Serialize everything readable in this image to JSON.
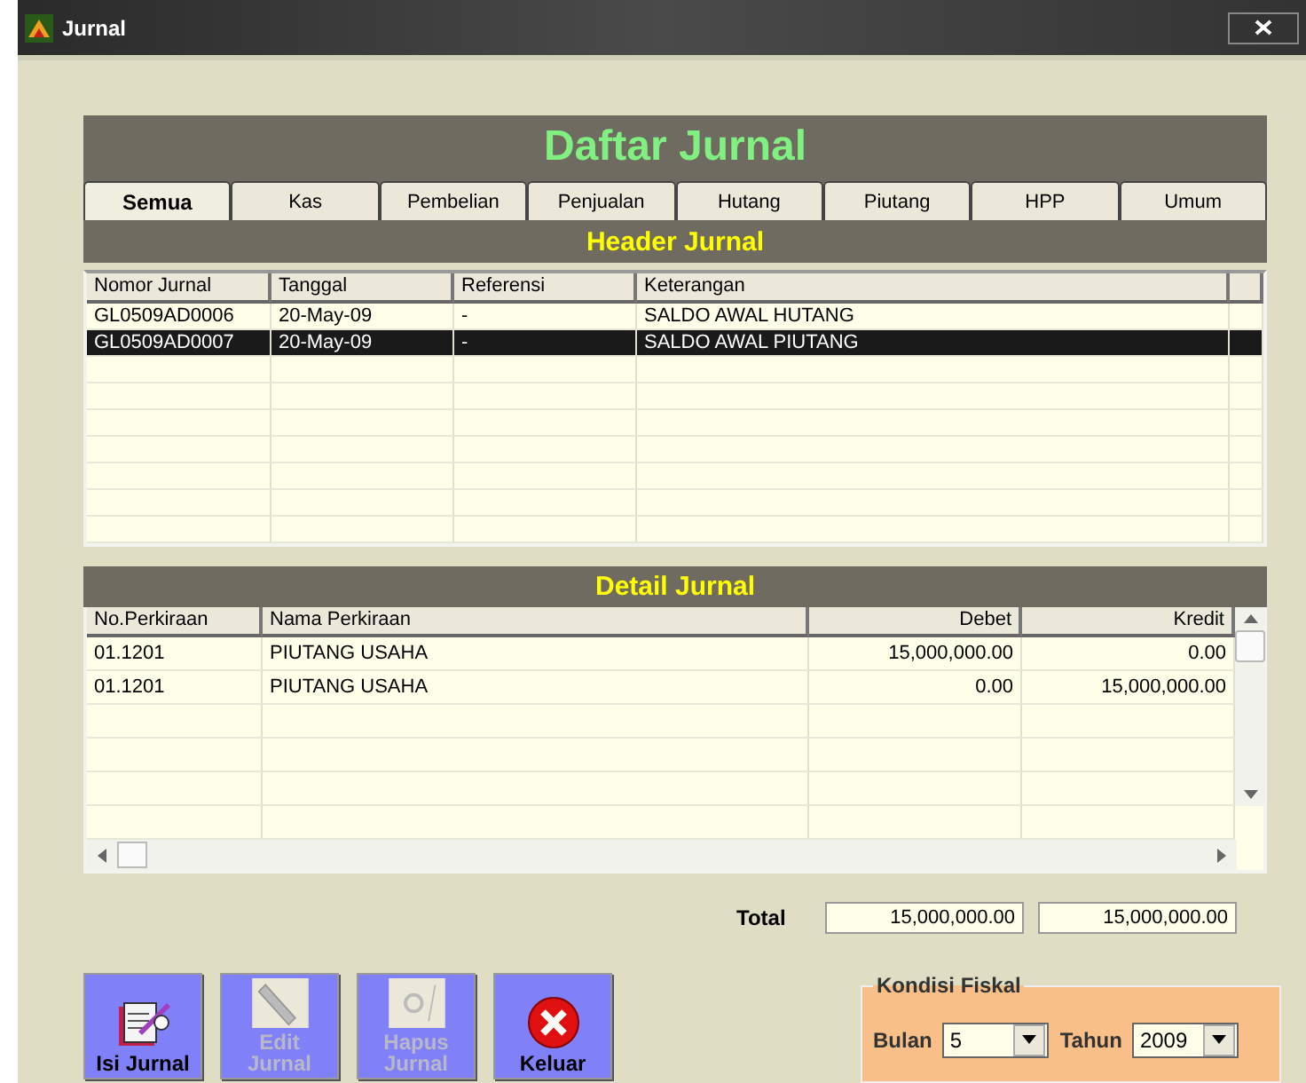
{
  "window": {
    "title": "Jurnal"
  },
  "heading": "Daftar Jurnal",
  "tabs": [
    {
      "label": "Semua",
      "selected": true
    },
    {
      "label": "Kas",
      "selected": false
    },
    {
      "label": "Pembelian",
      "selected": false
    },
    {
      "label": "Penjualan",
      "selected": false
    },
    {
      "label": "Hutang",
      "selected": false
    },
    {
      "label": "Piutang",
      "selected": false
    },
    {
      "label": "HPP",
      "selected": false
    },
    {
      "label": "Umum",
      "selected": false
    }
  ],
  "header_section": {
    "title": "Header Jurnal",
    "columns": [
      "Nomor Jurnal",
      "Tanggal",
      "Referensi",
      "Keterangan"
    ],
    "rows": [
      {
        "cells": [
          "GL0509AD0006",
          "20-May-09",
          "-",
          "SALDO AWAL HUTANG"
        ],
        "selected": false
      },
      {
        "cells": [
          "GL0509AD0007",
          "20-May-09",
          "-",
          "SALDO AWAL PIUTANG"
        ],
        "selected": true
      }
    ]
  },
  "detail_section": {
    "title": "Detail Jurnal",
    "columns": [
      "No.Perkiraan",
      "Nama Perkiraan",
      "Debet",
      "Kredit"
    ],
    "rows": [
      [
        "01.1201",
        "PIUTANG USAHA",
        "15,000,000.00",
        "0.00"
      ],
      [
        "01.1201",
        "PIUTANG USAHA",
        "0.00",
        "15,000,000.00"
      ]
    ]
  },
  "total": {
    "label": "Total",
    "debet": "15,000,000.00",
    "kredit": "15,000,000.00"
  },
  "buttons": [
    {
      "label": "Isi Jurnal",
      "kind": "notebook",
      "disabled": false
    },
    {
      "label": "Edit Jurnal",
      "kind": "edit",
      "disabled": true
    },
    {
      "label": "Hapus Jurnal",
      "kind": "delete",
      "disabled": true
    },
    {
      "label": "Keluar",
      "kind": "exit",
      "disabled": false
    }
  ],
  "fiscal": {
    "title": "Kondisi Fiskal",
    "month_label": "Bulan",
    "month": "5",
    "year_label": "Tahun",
    "year": "2009"
  }
}
